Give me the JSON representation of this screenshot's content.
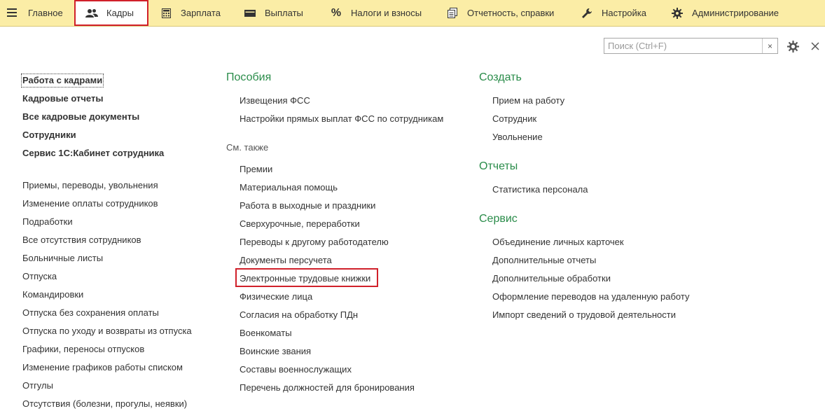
{
  "menu": {
    "hamburger_icon": "hamburger-icon",
    "items": [
      {
        "label": "Главное",
        "icon": "none"
      },
      {
        "label": "Кадры",
        "icon": "users-icon",
        "active": true
      },
      {
        "label": "Зарплата",
        "icon": "calculator-icon"
      },
      {
        "label": "Выплаты",
        "icon": "wallet-icon"
      },
      {
        "label": "Налоги и взносы",
        "icon": "percent-icon"
      },
      {
        "label": "Отчетность, справки",
        "icon": "documents-icon"
      },
      {
        "label": "Настройка",
        "icon": "wrench-icon"
      },
      {
        "label": "Администрирование",
        "icon": "gear-icon"
      }
    ]
  },
  "search": {
    "placeholder": "Поиск (Ctrl+F)",
    "clear_label": "×"
  },
  "toolbar": {
    "settings_icon": "gear-icon",
    "close_icon": "close-icon"
  },
  "left": {
    "main_links": [
      "Работа с кадрами",
      "Кадровые отчеты",
      "Все кадровые документы",
      "Сотрудники",
      "Сервис 1С:Кабинет сотрудника"
    ],
    "links": [
      "Приемы, переводы, увольнения",
      "Изменение оплаты сотрудников",
      "Подработки",
      "Все отсутствия сотрудников",
      "Больничные листы",
      "Отпуска",
      "Командировки",
      "Отпуска без сохранения оплаты",
      "Отпуска по уходу и возвраты из отпуска",
      "Графики, переносы отпусков",
      "Изменение графиков работы списком",
      "Отгулы",
      "Отсутствия (болезни, прогулы, неявки)"
    ]
  },
  "middle": {
    "section_title": "Пособия",
    "benefits_links": [
      "Извещения ФСС",
      "Настройки прямых выплат ФСС по сотрудникам"
    ],
    "see_also_title": "См. также",
    "see_also_links": [
      "Премии",
      "Материальная помощь",
      "Работа в выходные и праздники",
      "Сверхурочные, переработки",
      "Переводы к другому работодателю",
      "Документы персучета",
      "Электронные трудовые книжки",
      "Физические лица",
      "Согласия на обработку ПДн",
      "Военкоматы",
      "Воинские звания",
      "Составы военнослужащих",
      "Перечень должностей для бронирования"
    ]
  },
  "right": {
    "create_title": "Создать",
    "create_links": [
      "Прием на работу",
      "Сотрудник",
      "Увольнение"
    ],
    "reports_title": "Отчеты",
    "reports_links": [
      "Статистика персонала"
    ],
    "service_title": "Сервис",
    "service_links": [
      "Объединение личных карточек",
      "Дополнительные отчеты",
      "Дополнительные обработки",
      "Оформление переводов на удаленную работу",
      "Импорт сведений о трудовой деятельности"
    ]
  },
  "colors": {
    "menu_bg": "#fbeda6",
    "section_green": "#2a8c4a",
    "highlight_red": "#d0202a"
  }
}
